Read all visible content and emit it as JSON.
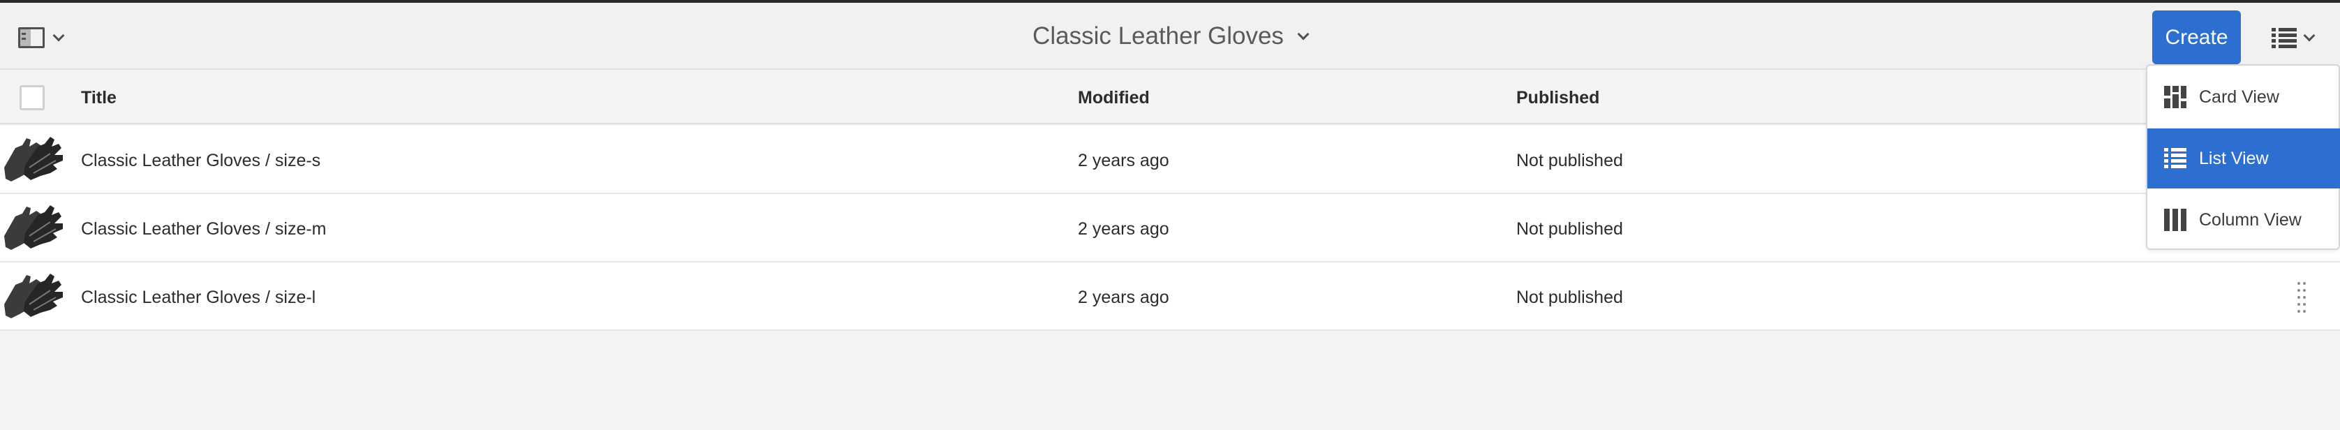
{
  "header": {
    "title": "Classic Leather Gloves",
    "create_label": "Create"
  },
  "table": {
    "columns": {
      "title": "Title",
      "modified": "Modified",
      "published": "Published"
    },
    "rows": [
      {
        "title": "Classic Leather Gloves / size-s",
        "modified": "2 years ago",
        "published": "Not published",
        "thumbnail": "leather-gloves-thumbnail"
      },
      {
        "title": "Classic Leather Gloves / size-m",
        "modified": "2 years ago",
        "published": "Not published",
        "thumbnail": "leather-gloves-thumbnail"
      },
      {
        "title": "Classic Leather Gloves / size-l",
        "modified": "2 years ago",
        "published": "Not published",
        "thumbnail": "leather-gloves-thumbnail"
      }
    ]
  },
  "view_menu": {
    "items": [
      {
        "label": "Card View",
        "icon": "card-view-icon",
        "selected": false
      },
      {
        "label": "List View",
        "icon": "list-view-icon",
        "selected": true
      },
      {
        "label": "Column View",
        "icon": "column-view-icon",
        "selected": false
      }
    ]
  },
  "colors": {
    "accent": "#2d6fd1",
    "background": "#f4f4f4",
    "row_background": "#ffffff"
  },
  "icons": {
    "rail_toggle": "side-panel-icon",
    "title_dropdown": "chevron-down-icon",
    "view_switcher": "list-view-icon",
    "row_handle": "drag-handle-icon"
  }
}
